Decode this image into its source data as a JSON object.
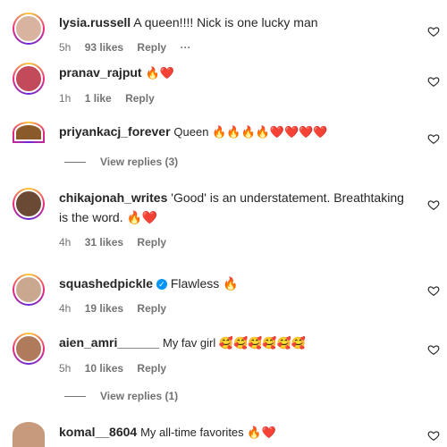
{
  "comments": [
    {
      "username": "lysia.russell",
      "text": "A queen!!!! Nick is one lucky man",
      "time": "5h",
      "likes": "93 likes",
      "reply": "Reply",
      "more": "···",
      "avatar_color": "#d8b4a0"
    },
    {
      "username": "pranav_rajput",
      "text": "🔥❤️",
      "time": "1h",
      "likes": "1 like",
      "reply": "Reply",
      "avatar_color": "#c24a5a"
    },
    {
      "username": "priyankacj_forever",
      "text": "Queen 🔥🔥🔥🔥❤️❤️❤️❤️",
      "avatar_color": "#8b5a2b"
    },
    {
      "username": "chikajonah_writes",
      "text": "'Good' is an understatement. Breathtaking is the word. 🔥❤️",
      "time": "4h",
      "likes": "31 likes",
      "reply": "Reply",
      "avatar_color": "#6b4a35"
    },
    {
      "username": "squashedpickle",
      "text": "Flawless 🔥",
      "time": "4h",
      "likes": "19 likes",
      "reply": "Reply",
      "avatar_color": "#caa890"
    },
    {
      "username": "aien_amri______",
      "text": "My fav girl 🥰🥰🥰🥰🥰🥰",
      "time": "5h",
      "likes": "10 likes",
      "reply": "Reply",
      "avatar_color": "#b07a5c"
    },
    {
      "username": "komal__8604",
      "text": "My all-time favorites 🔥❤️",
      "avatar_color": "#c79a7b"
    }
  ],
  "view_replies": [
    "View replies (3)",
    "View replies (1)"
  ],
  "verified_icon": "blue-check-icon",
  "accent": "#0095f6"
}
